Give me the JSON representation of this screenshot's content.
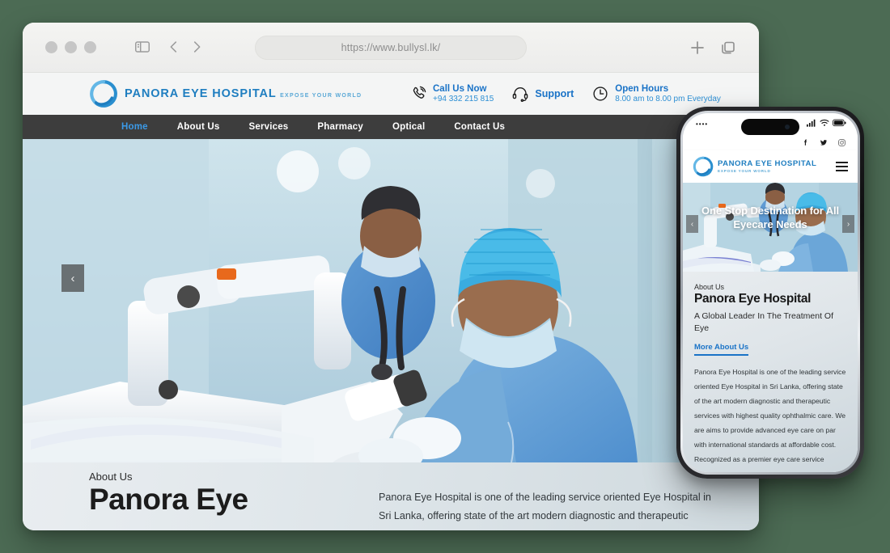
{
  "browser": {
    "url": "https://www.bullysl.lk/",
    "traffic_lights": [
      "close",
      "minimize",
      "maximize"
    ],
    "icons": {
      "sidebar": "sidebar-toggle-icon",
      "back": "back-chevron-icon",
      "forward": "forward-chevron-icon",
      "new_tab": "plus-icon",
      "tab_overview": "tab-overview-icon"
    }
  },
  "site": {
    "logo": {
      "name": "PANORA EYE HOSPITAL",
      "tagline": "EXPOSE YOUR WORLD"
    },
    "contact": [
      {
        "icon": "phone-icon",
        "title": "Call Us Now",
        "detail": "+94 332 215 815"
      },
      {
        "icon": "headset-icon",
        "title": "Support",
        "detail": ""
      },
      {
        "icon": "clock-icon",
        "title": "Open Hours",
        "detail": "8.00 am to 8.00 pm Everyday"
      }
    ],
    "nav": [
      {
        "label": "Home",
        "active": true
      },
      {
        "label": "About Us",
        "active": false
      },
      {
        "label": "Services",
        "active": false
      },
      {
        "label": "Pharmacy",
        "active": false
      },
      {
        "label": "Optical",
        "active": false
      },
      {
        "label": "Contact Us",
        "active": false
      }
    ],
    "hero": {
      "prev_arrow": "‹",
      "next_arrow": "›",
      "alt": "Two eye surgeons in blue scrubs operating an ophthalmic surgical microscope"
    },
    "about": {
      "kicker": "About Us",
      "title": "Panora Eye",
      "paragraph": "Panora Eye Hospital is one of the leading service oriented Eye Hospital in Sri Lanka, offering state of the art modern diagnostic and therapeutic services"
    }
  },
  "phone": {
    "status": {
      "time": "••••",
      "signal": "signal-icon",
      "wifi": "wifi-icon",
      "battery": "battery-icon"
    },
    "social": [
      "facebook-icon",
      "twitter-icon",
      "instagram-icon"
    ],
    "logo": {
      "name": "PANORA EYE HOSPITAL",
      "tagline": "EXPOSE YOUR WORLD"
    },
    "menu_icon": "hamburger-menu-icon",
    "hero": {
      "title": "One Stop Destination for All Eyecare Needs",
      "prev_arrow": "‹",
      "next_arrow": "›"
    },
    "about": {
      "kicker": "About Us",
      "title": "Panora Eye Hospital",
      "subtitle": "A Global Leader In The Treatment Of Eye",
      "link": "More About Us",
      "paragraph": "Panora Eye Hospital is one of the leading service oriented Eye Hospital in Sri Lanka, offering state of the art modern diagnostic and therapeutic services with highest quality ophthalmic care. We are aims to provide advanced eye care on par with international standards at affordable cost. Recognized as a premier eye care service provider, Panora Eye Hospital is empaneled with various national organizations and leading health insurance companies."
    }
  },
  "colors": {
    "page_background": "#4c6b54",
    "brand_blue": "#1f7ec0",
    "accent_blue": "#3b9ae8",
    "nav_background": "#3d3d3d"
  }
}
